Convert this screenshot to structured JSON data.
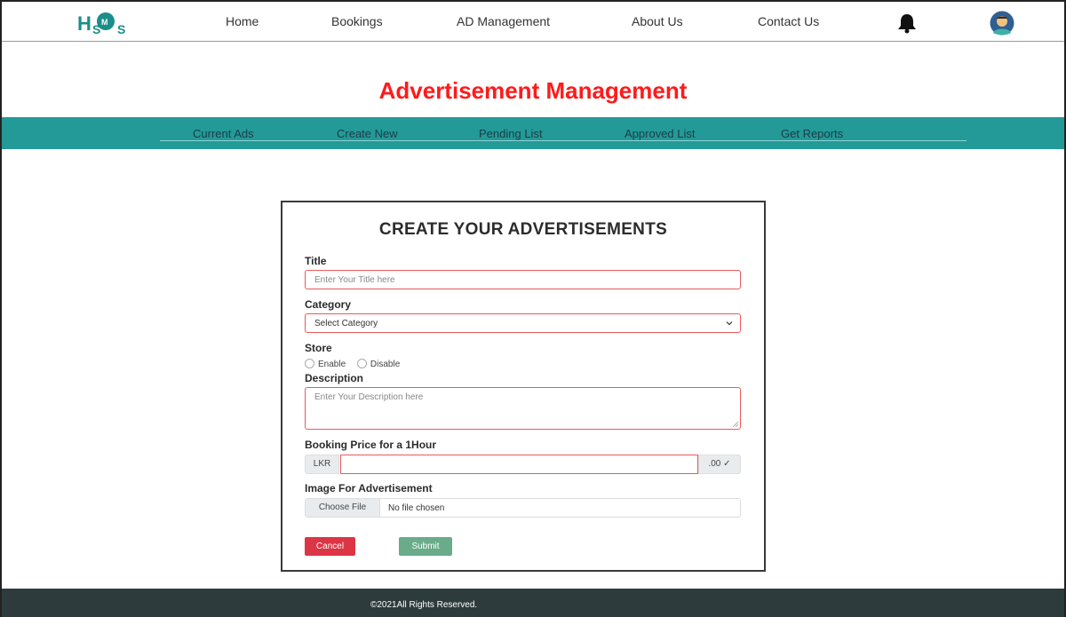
{
  "nav": {
    "logo_text": "HSMS",
    "links": [
      "Home",
      "Bookings",
      "AD Management",
      "About Us",
      "Contact Us"
    ],
    "icons": [
      "bell-icon",
      "avatar-icon"
    ]
  },
  "page": {
    "title": "Advertisement Management"
  },
  "tabs": [
    "Current Ads",
    "Create New",
    "Pending List",
    "Approved List",
    "Get Reports"
  ],
  "form": {
    "heading": "CREATE YOUR ADVERTISEMENTS",
    "title_label": "Title",
    "title_placeholder": "Enter Your Title here",
    "category_label": "Category",
    "category_selected": "Select Category",
    "store_label": "Store",
    "store_options": [
      "Enable",
      "Disable"
    ],
    "description_label": "Description",
    "description_placeholder": "Enter Your Description here",
    "price_label": "Booking Price for a 1Hour",
    "price_prefix": "LKR",
    "price_value": "",
    "price_suffix": ".00 ✓",
    "image_label": "Image For Advertisement",
    "file_button": "Choose File",
    "file_status": "No file chosen",
    "cancel_button": "Cancel",
    "submit_button": "Submit"
  },
  "footer": {
    "text": "©2021All Rights Reserved."
  },
  "colors": {
    "accent_teal": "#239a97",
    "title_red": "#ff1a1a",
    "cancel_red": "#dc3545",
    "submit_green": "#6aab8a",
    "footer_bg": "#2d3b3c"
  }
}
